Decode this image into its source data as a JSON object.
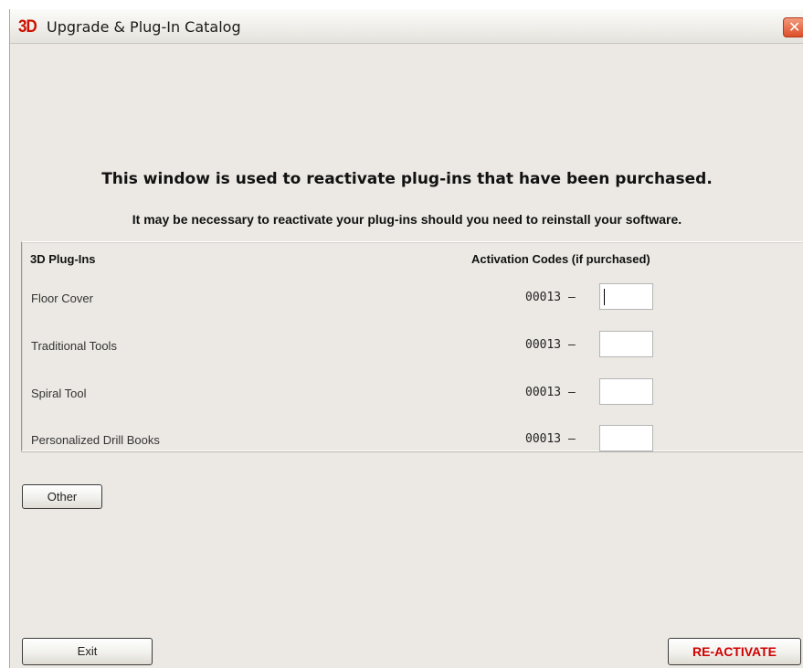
{
  "window": {
    "logo": "3D",
    "title": "Upgrade & Plug-In Catalog",
    "close_glyph": "✕"
  },
  "intro": {
    "heading": "This window is used to reactivate plug-ins that have been purchased.",
    "subheading": "It may be necessary to reactivate your plug-ins should you need to reinstall your software."
  },
  "table": {
    "col_plugins": "3D Plug-Ins",
    "col_codes": "Activation Codes (if purchased)",
    "rows": [
      {
        "name": "Floor Cover",
        "prefix": "00013  –",
        "code": ""
      },
      {
        "name": "Traditional Tools",
        "prefix": "00013  –",
        "code": ""
      },
      {
        "name": "Spiral Tool",
        "prefix": "00013  –",
        "code": ""
      },
      {
        "name": "Personalized Drill Books",
        "prefix": "00013  –",
        "code": ""
      }
    ]
  },
  "buttons": {
    "other": "Other",
    "exit": "Exit",
    "reactivate": "RE-ACTIVATE"
  },
  "colors": {
    "window_bg": "#ece9e4",
    "logo": "#cc1100",
    "reactivate_text": "#d00000",
    "close_button": "#de4e2a"
  },
  "icons": {
    "logo": "3d-logo-icon",
    "close": "close-icon"
  }
}
